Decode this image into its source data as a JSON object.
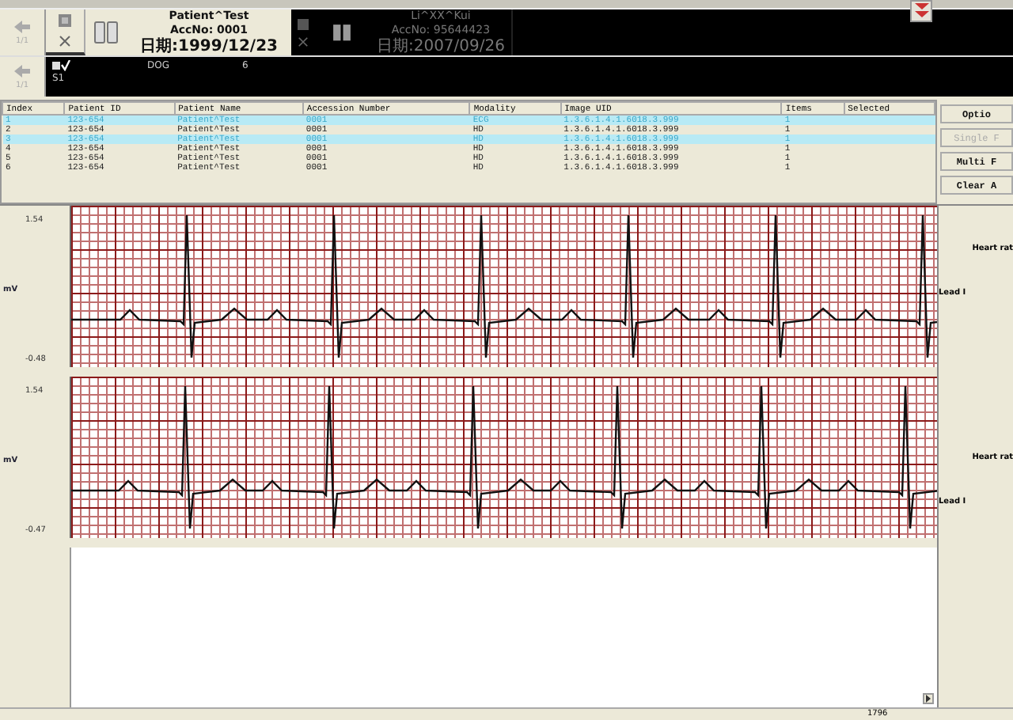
{
  "navigator": [
    {
      "page": "1/1"
    },
    {
      "page": "1/1"
    }
  ],
  "patient_cards": [
    {
      "name": "Patient^Test",
      "acc_no": "AccNo: 0001",
      "date": "日期:1999/12/23",
      "selected": true
    },
    {
      "name": "Li^XX^Kui",
      "acc_no": "AccNo: 95644423",
      "date": "日期:2007/09/26",
      "selected": false
    }
  ],
  "series": {
    "label": "S1",
    "modality": "DOG",
    "count": "6"
  },
  "table": {
    "columns": [
      "Index",
      "Patient ID",
      "Patient Name",
      "Accession Number",
      "Modality",
      "Image UID",
      "Items",
      "Selected"
    ],
    "rows": [
      {
        "cells": [
          "1",
          "123-654",
          "Patient^Test",
          "0001",
          "ECG",
          "1.3.6.1.4.1.6018.3.999",
          "1",
          ""
        ],
        "selected": true
      },
      {
        "cells": [
          "2",
          "123-654",
          "Patient^Test",
          "0001",
          "HD",
          "1.3.6.1.4.1.6018.3.999",
          "1",
          ""
        ],
        "selected": false
      },
      {
        "cells": [
          "3",
          "123-654",
          "Patient^Test",
          "0001",
          "HD",
          "1.3.6.1.4.1.6018.3.999",
          "1",
          ""
        ],
        "selected": true
      },
      {
        "cells": [
          "4",
          "123-654",
          "Patient^Test",
          "0001",
          "HD",
          "1.3.6.1.4.1.6018.3.999",
          "1",
          ""
        ],
        "selected": false
      },
      {
        "cells": [
          "5",
          "123-654",
          "Patient^Test",
          "0001",
          "HD",
          "1.3.6.1.4.1.6018.3.999",
          "1",
          ""
        ],
        "selected": false
      },
      {
        "cells": [
          "6",
          "123-654",
          "Patient^Test",
          "0001",
          "HD",
          "1.3.6.1.4.1.6018.3.999",
          "1",
          ""
        ],
        "selected": false
      }
    ]
  },
  "buttons": [
    {
      "label": "Optio",
      "disabled": false
    },
    {
      "label": "Single F",
      "disabled": true
    },
    {
      "label": "Multi F",
      "disabled": false
    },
    {
      "label": "Clear A",
      "disabled": false
    }
  ],
  "strips": [
    {
      "max": "1.54",
      "unit": "mV",
      "min": "-0.48",
      "heart_rate": "Heart rat",
      "lead": "Lead I"
    },
    {
      "max": "1.54",
      "unit": "mV",
      "min": "-0.47",
      "heart_rate": "Heart rat",
      "lead": "Lead I"
    }
  ],
  "status_bar": {
    "value": "1796"
  }
}
